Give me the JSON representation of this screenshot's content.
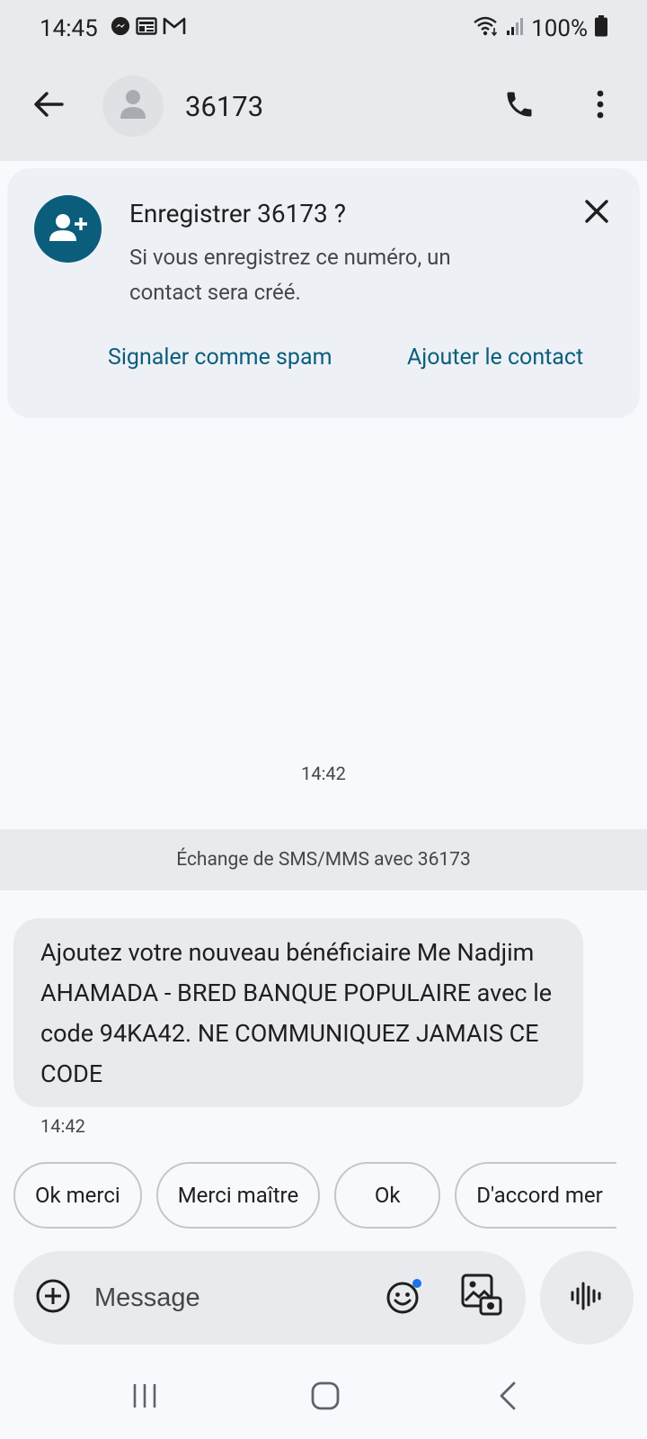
{
  "status_bar": {
    "time": "14:45",
    "icons_left": [
      "messenger-icon",
      "news-icon",
      "gmail-icon"
    ],
    "icons_right": [
      "wifi-icon",
      "signal-icon",
      "battery-icon"
    ],
    "battery": "100%"
  },
  "header": {
    "contact": "36173",
    "icons": [
      "back-arrow-icon",
      "person-icon",
      "phone-icon",
      "more-vert-icon"
    ]
  },
  "save_card": {
    "title": "Enregistrer 36173 ?",
    "body": "Si vous enregistrez ce numéro, un contact sera créé.",
    "spam_label": "Signaler comme spam",
    "add_label": "Ajouter le contact",
    "icons": [
      "person-add-icon",
      "close-icon"
    ]
  },
  "conversation": {
    "timestamp_center": "14:42",
    "banner": "Échange de SMS/MMS avec 36173",
    "message": "Ajoutez votre nouveau bénéficiaire Me Nadjim AHAMADA - BRED BANQUE POPULAIRE avec le code 94KA42. NE COMMUNIQUEZ JAMAIS CE CODE",
    "message_time": "14:42"
  },
  "suggestions": [
    "Ok merci",
    "Merci maître",
    "Ok",
    "D'accord mer"
  ],
  "composer": {
    "placeholder": "Message",
    "icons": [
      "add-circle-icon",
      "emoji-icon",
      "gallery-icon",
      "voice-icon"
    ]
  },
  "nav_icons": [
    "recents-icon",
    "home-icon",
    "back-icon"
  ],
  "colors": {
    "accent": "#0b5d7c",
    "bubble": "#e9eaee",
    "bar": "#e8eaed",
    "background": "#f8f9fd",
    "badge_dot": "#1a73e8"
  }
}
